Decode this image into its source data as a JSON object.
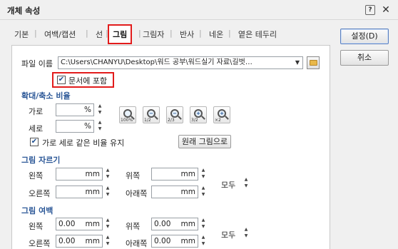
{
  "window": {
    "title": "개체 속성",
    "help_symbol": "?",
    "close_symbol": "✕"
  },
  "tabs": [
    {
      "label": "기본"
    },
    {
      "label": "여백/캡션"
    },
    {
      "label": "선"
    },
    {
      "label": "그림"
    },
    {
      "label": "그림자"
    },
    {
      "label": "반사"
    },
    {
      "label": "네온"
    },
    {
      "label": "옅은 테두리"
    }
  ],
  "active_tab": "그림",
  "file": {
    "label": "파일 이름",
    "value": "C:\\Users\\CHANYU\\Desktop\\워드 공부\\워드실기 자료\\길벗…",
    "include_in_document": {
      "label": "문서에 포함",
      "checked": true
    }
  },
  "scale": {
    "section_title": "확대/축소 비율",
    "width": {
      "label": "가로",
      "value": "",
      "unit": "%"
    },
    "height": {
      "label": "세로",
      "value": "",
      "unit": "%"
    },
    "zoom_buttons": [
      {
        "name": "zoom-100-icon",
        "caption": "100%"
      },
      {
        "name": "zoom-half-icon",
        "caption": "1/2"
      },
      {
        "name": "zoom-two-thirds-icon",
        "caption": "2/3"
      },
      {
        "name": "zoom-three-halves-icon",
        "caption": "3/2"
      },
      {
        "name": "zoom-double-icon",
        "caption": "×2"
      }
    ],
    "keep_ratio": {
      "label": "가로 세로 같은 비율 유지",
      "checked": true
    },
    "original_button": "원래 그림으로"
  },
  "crop": {
    "section_title": "그림 자르기",
    "left": {
      "label": "왼쪽",
      "value": "",
      "unit": "mm"
    },
    "top": {
      "label": "위쪽",
      "value": "",
      "unit": "mm"
    },
    "right": {
      "label": "오른쪽",
      "value": "",
      "unit": "mm"
    },
    "bottom": {
      "label": "아래쪽",
      "value": "",
      "unit": "mm"
    },
    "all": {
      "label": "모두"
    }
  },
  "margin": {
    "section_title": "그림 여백",
    "left": {
      "label": "왼쪽",
      "value": "0.00",
      "unit": "mm"
    },
    "top": {
      "label": "위쪽",
      "value": "0.00",
      "unit": "mm"
    },
    "right": {
      "label": "오른쪽",
      "value": "0.00",
      "unit": "mm"
    },
    "bottom": {
      "label": "아래쪽",
      "value": "0.00",
      "unit": "mm"
    },
    "all": {
      "label": "모두"
    }
  },
  "buttons": {
    "ok": "설정(D)",
    "cancel": "취소"
  },
  "colors": {
    "highlight": "#e21c1c",
    "section": "#2b5797"
  }
}
